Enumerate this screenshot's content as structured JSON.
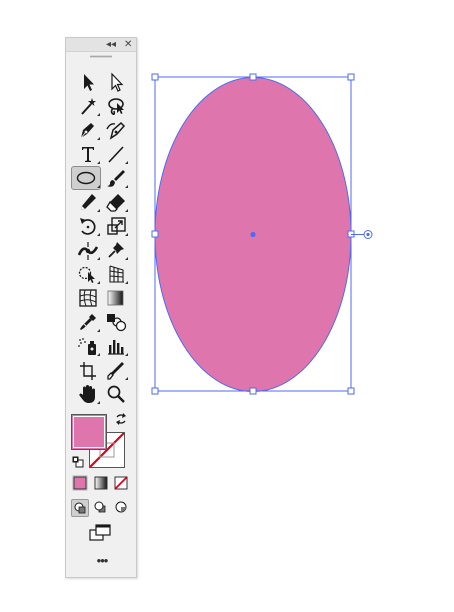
{
  "toolbar": {
    "collapse_glyph": "◂◂",
    "close_glyph": "✕",
    "more_glyph": "•••",
    "tools": [
      {
        "name": "selection-tool",
        "icon": "arrow-filled-icon"
      },
      {
        "name": "direct-selection-tool",
        "icon": "arrow-hollow-icon"
      },
      {
        "name": "magic-wand-tool",
        "icon": "magic-wand-icon"
      },
      {
        "name": "lasso-tool",
        "icon": "lasso-icon"
      },
      {
        "name": "pen-tool",
        "icon": "pen-icon"
      },
      {
        "name": "curvature-tool",
        "icon": "curvature-pen-icon"
      },
      {
        "name": "type-tool",
        "icon": "type-icon",
        "label": "T"
      },
      {
        "name": "line-segment-tool",
        "icon": "line-icon"
      },
      {
        "name": "ellipse-tool",
        "icon": "ellipse-icon",
        "selected": true
      },
      {
        "name": "paintbrush-tool",
        "icon": "brush-icon"
      },
      {
        "name": "pencil-tool",
        "icon": "pencil-icon"
      },
      {
        "name": "eraser-tool",
        "icon": "eraser-icon"
      },
      {
        "name": "rotate-tool",
        "icon": "rotate-icon"
      },
      {
        "name": "scale-tool",
        "icon": "scale-icon"
      },
      {
        "name": "width-tool",
        "icon": "width-icon"
      },
      {
        "name": "puppet-warp-tool",
        "icon": "pin-icon"
      },
      {
        "name": "shape-builder-tool",
        "icon": "shape-builder-icon"
      },
      {
        "name": "perspective-grid-tool",
        "icon": "perspective-grid-icon"
      },
      {
        "name": "mesh-tool",
        "icon": "mesh-icon"
      },
      {
        "name": "gradient-tool",
        "icon": "gradient-icon"
      },
      {
        "name": "eyedropper-tool",
        "icon": "eyedropper-icon"
      },
      {
        "name": "blend-tool",
        "icon": "blend-icon"
      },
      {
        "name": "symbol-sprayer-tool",
        "icon": "symbol-sprayer-icon"
      },
      {
        "name": "column-graph-tool",
        "icon": "bar-graph-icon"
      },
      {
        "name": "artboard-tool",
        "icon": "artboard-icon"
      },
      {
        "name": "slice-tool",
        "icon": "slice-icon"
      },
      {
        "name": "hand-tool",
        "icon": "hand-icon"
      },
      {
        "name": "zoom-tool",
        "icon": "zoom-icon"
      }
    ],
    "fill_color": "#de76ad",
    "stroke": "none",
    "color_modes": [
      "color",
      "gradient",
      "none"
    ],
    "drawing_modes": [
      "draw-normal",
      "draw-behind",
      "draw-inside"
    ],
    "active_drawing_mode": "draw-normal"
  },
  "canvas": {
    "ellipse_fill": "#de76ad",
    "selection_color": "#4f6bf2"
  }
}
